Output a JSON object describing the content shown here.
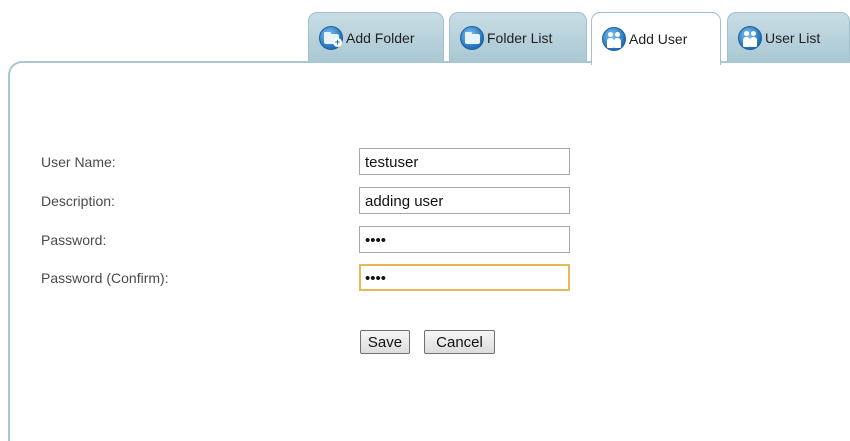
{
  "tabs": [
    {
      "label": "Add Folder",
      "icon": "folder-add-icon",
      "active": false
    },
    {
      "label": "Folder List",
      "icon": "folder-icon",
      "active": false
    },
    {
      "label": "Add User",
      "icon": "user-add-icon",
      "active": true
    },
    {
      "label": "User List",
      "icon": "users-icon",
      "active": false
    }
  ],
  "form": {
    "username": {
      "label": "User Name:",
      "value": "testuser"
    },
    "description": {
      "label": "Description:",
      "value": "adding user"
    },
    "password": {
      "label": "Password:",
      "value": "abcd"
    },
    "confirm": {
      "label": "Password (Confirm):",
      "value": "abcd"
    }
  },
  "buttons": {
    "save": "Save",
    "cancel": "Cancel"
  },
  "colors": {
    "tab_background": "#a9c7d2",
    "panel_border": "#a9c7d2",
    "focus_border": "#e8b957"
  }
}
